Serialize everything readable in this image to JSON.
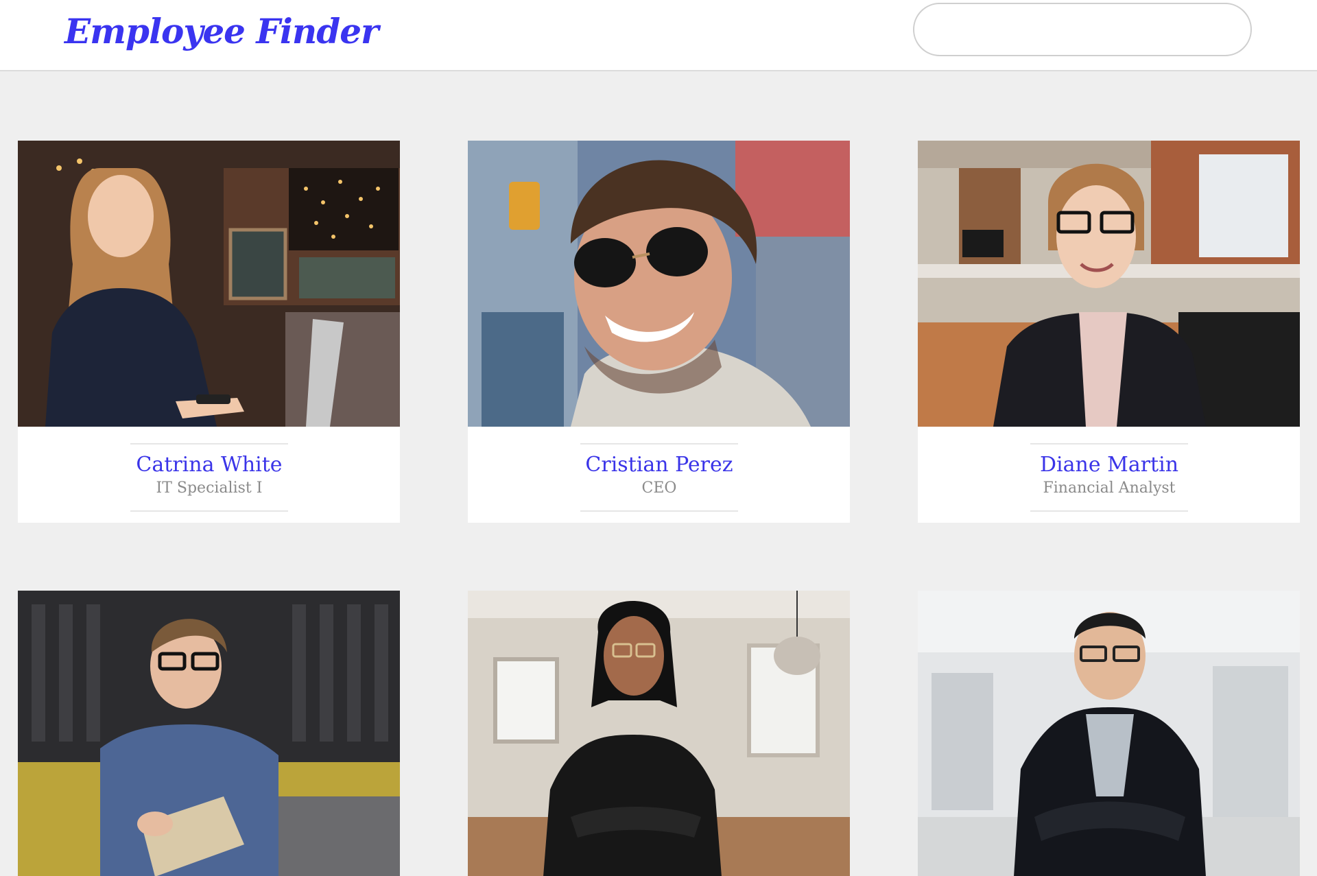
{
  "header": {
    "logo_text": "Employee Finder",
    "search_value": "",
    "search_placeholder": ""
  },
  "colors": {
    "accent": "#3a34f0",
    "background": "#efefef",
    "card": "#ffffff",
    "muted_text": "#8a8a8a"
  },
  "employees": [
    {
      "name": "Catrina White",
      "title": "IT Specialist I",
      "photo": "woman-laptop-cafe-photo"
    },
    {
      "name": "Cristian Perez",
      "title": "CEO",
      "photo": "man-sunglasses-photo"
    },
    {
      "name": "Diane Martin",
      "title": "Financial Analyst",
      "photo": "woman-glasses-office-photo"
    },
    {
      "name": "",
      "title": "",
      "photo": "man-writing-notebook-photo"
    },
    {
      "name": "",
      "title": "",
      "photo": "woman-arms-crossed-photo"
    },
    {
      "name": "",
      "title": "",
      "photo": "man-arms-crossed-photo"
    }
  ]
}
